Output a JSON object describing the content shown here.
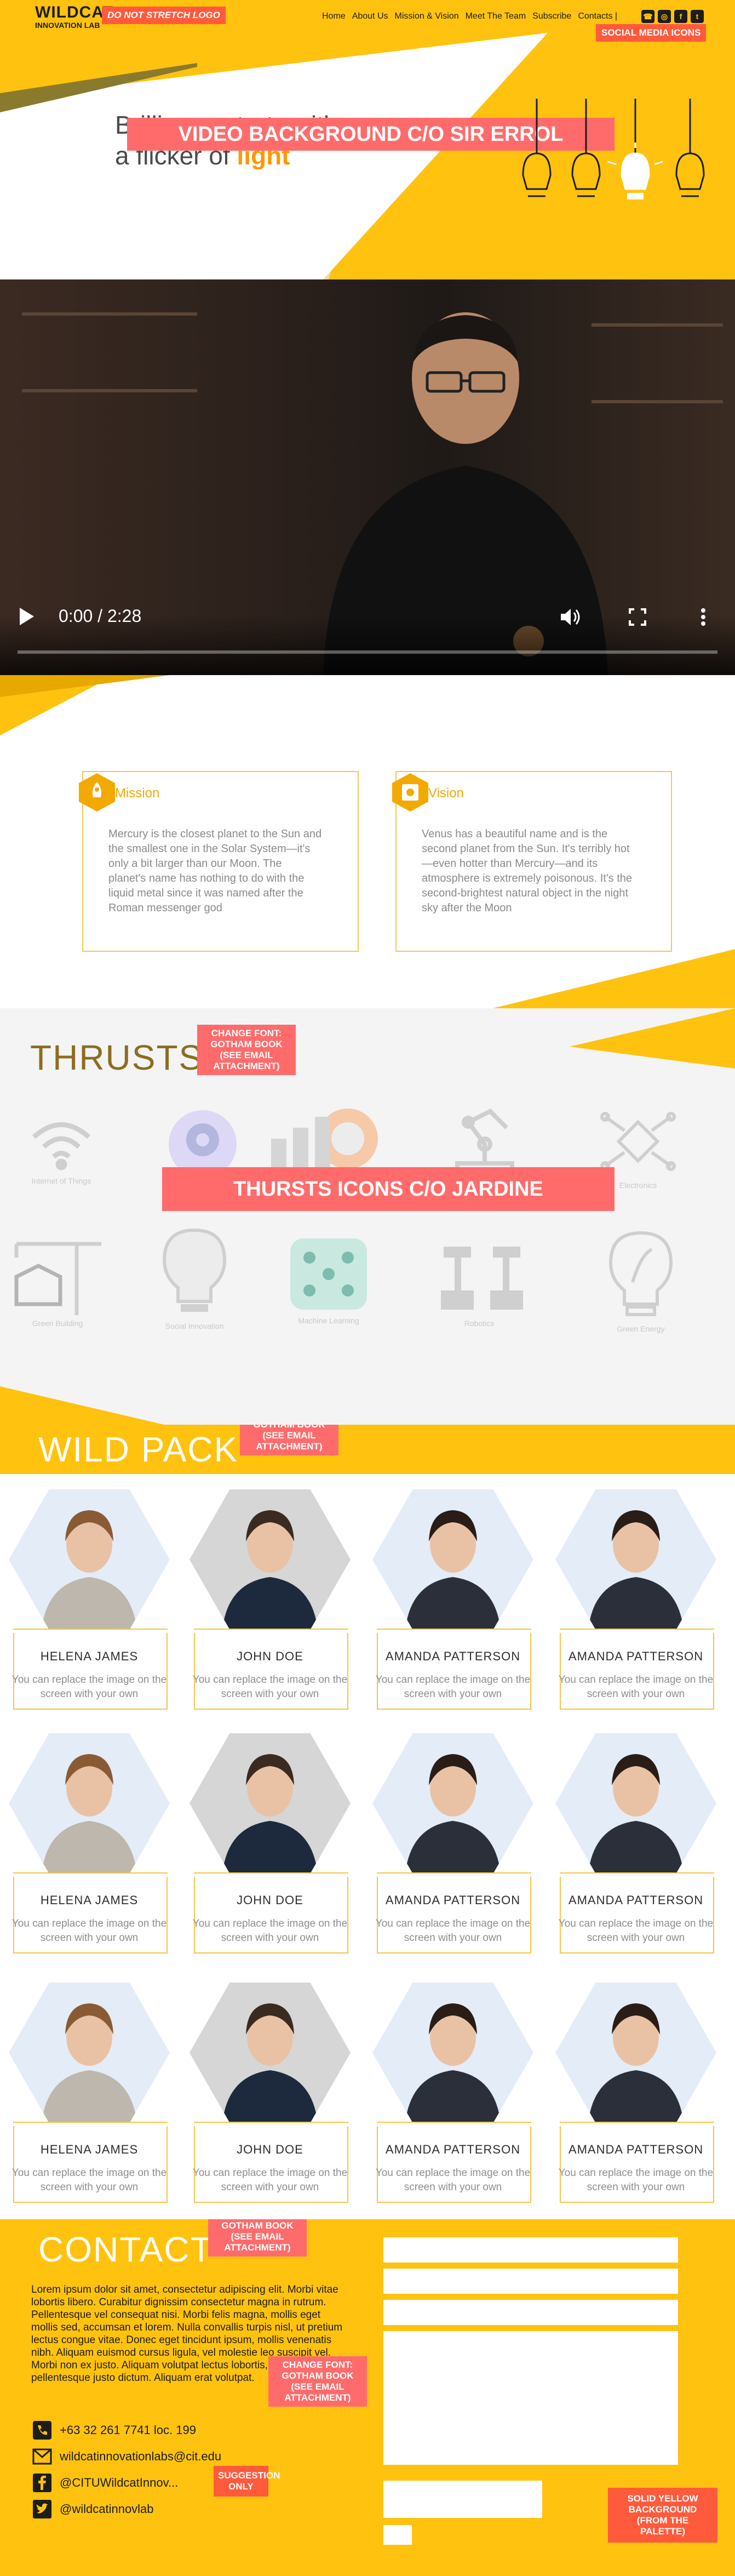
{
  "brand": {
    "logo_line1": "WILDCAT",
    "logo_line2": "INNOVATION LAB"
  },
  "nav": {
    "items": [
      "Home",
      "About Us",
      "Mission & Vision",
      "Meet The Team",
      "Subscribe",
      "Contacts |"
    ]
  },
  "social_icons": [
    "phone-icon",
    "instagram-icon",
    "facebook-icon",
    "twitter-icon"
  ],
  "hero": {
    "tagline_line1": "Brilliance starts with",
    "tagline_line2_prefix": "a flicker of ",
    "tagline_highlight": "light"
  },
  "notes": {
    "logo": "DO NOT STRETCH LOGO",
    "social": "SOCIAL MEDIA ICONS",
    "video": "VIDEO BACKGROUND C/O SIR ERROL",
    "font_thrusts": "CHANGE FONT: GOTHAM BOOK (SEE EMAIL ATTACHMENT)",
    "thrust_icons": "THURSTS ICONS C/O JARDINE",
    "font_pack": "CHANGE FONT: GOTHAM BOOK (SEE EMAIL ATTACHMENT)",
    "font_contact": "CHANGE FONT: GOTHAM BOOK (SEE EMAIL ATTACHMENT)",
    "font_contact_body": "CHANGE FONT: GOTHAM BOOK (SEE EMAIL ATTACHMENT)",
    "suggestion": "SUGGESTION ONLY",
    "background": "SOLID YELLOW BACKGROUND (FROM THE PALETTE)"
  },
  "video": {
    "time": "0:00 / 2:28",
    "progress": 0
  },
  "mission": {
    "title": "Mission",
    "body": "Mercury is the closest planet to the Sun and the smallest one in the Solar System—it's only a bit larger than our Moon. The planet's name has nothing to do with the liquid metal since it was named after the Roman messenger god"
  },
  "vision": {
    "title": "Vision",
    "body": "Venus has a beautiful name and is the second planet from the Sun. It's terribly hot—even hotter than Mercury—and its atmosphere is extremely poisonous. It's the second-brightest natural object in the night sky after the Moon"
  },
  "thrusts": {
    "title": "THRUSTS",
    "items": [
      {
        "label": "Internet of Things",
        "icon": "wifi-icon"
      },
      {
        "label": "",
        "icon": "brain-gear-icon"
      },
      {
        "label": "",
        "icon": "analytics-icon"
      },
      {
        "label": "",
        "icon": "robot-arm-icon"
      },
      {
        "label": "Electronics",
        "icon": "circuit-icon"
      },
      {
        "label": "Green Building",
        "icon": "crane-icon"
      },
      {
        "label": "Social Innovation",
        "icon": "lightbulb-icon"
      },
      {
        "label": "Machine Learning",
        "icon": "network-icon"
      },
      {
        "label": "Robotics",
        "icon": "robots-icon"
      },
      {
        "label": "Green Energy",
        "icon": "eco-bulb-icon"
      }
    ]
  },
  "pack": {
    "title": "WILD PACK",
    "members": [
      {
        "name": "HELENA JAMES",
        "desc": "You can replace the image on the screen with your own"
      },
      {
        "name": "JOHN DOE",
        "desc": "You can replace the image on the screen with your own"
      },
      {
        "name": "AMANDA PATTERSON",
        "desc": "You can replace the image on the screen with your own"
      },
      {
        "name": "AMANDA PATTERSON",
        "desc": "You can replace the image on the screen with your own"
      },
      {
        "name": "HELENA JAMES",
        "desc": "You can replace the image on the screen with your own"
      },
      {
        "name": "JOHN DOE",
        "desc": "You can replace the image on the screen with your own"
      },
      {
        "name": "AMANDA PATTERSON",
        "desc": "You can replace the image on the screen with your own"
      },
      {
        "name": "AMANDA PATTERSON",
        "desc": "You can replace the image on the screen with your own"
      },
      {
        "name": "HELENA JAMES",
        "desc": "You can replace the image on the screen with your own"
      },
      {
        "name": "JOHN DOE",
        "desc": "You can replace the image on the screen with your own"
      },
      {
        "name": "AMANDA PATTERSON",
        "desc": "You can replace the image on the screen with your own"
      },
      {
        "name": "AMANDA PATTERSON",
        "desc": "You can replace the image on the screen with your own"
      }
    ]
  },
  "contact": {
    "title": "CONTACT",
    "lorem": "Lorem ipsum dolor sit amet, consectetur adipiscing elit. Morbi vitae lobortis libero. Curabitur dignissim consectetur magna in rutrum. Pellentesque vel consequat nisi. Morbi felis magna, mollis eget mollis sed, accumsan et lorem. Nulla convallis turpis nisl, ut pretium lectus congue vitae. Donec eget tincidunt ipsum, mollis venenatis nibh. Aliquam euismod cursus ligula, vel molestie leo suscipit vel. Morbi non ex justo. Aliquam volutpat lectus lobortis, sit amet pellentesque justo dictum. Aliquam erat volutpat.",
    "phone": "+63 32 261 7741 loc. 199",
    "email": "wildcatinnovationlabs@cit.edu",
    "facebook": "@CITUWildcatInnov...",
    "twitter": "@wildcatinnovlab"
  },
  "colors": {
    "accent": "#ffc20e",
    "note": "#ff5a3c",
    "note_pink": "#ff6b6b",
    "olive": "#8c6d1f"
  }
}
